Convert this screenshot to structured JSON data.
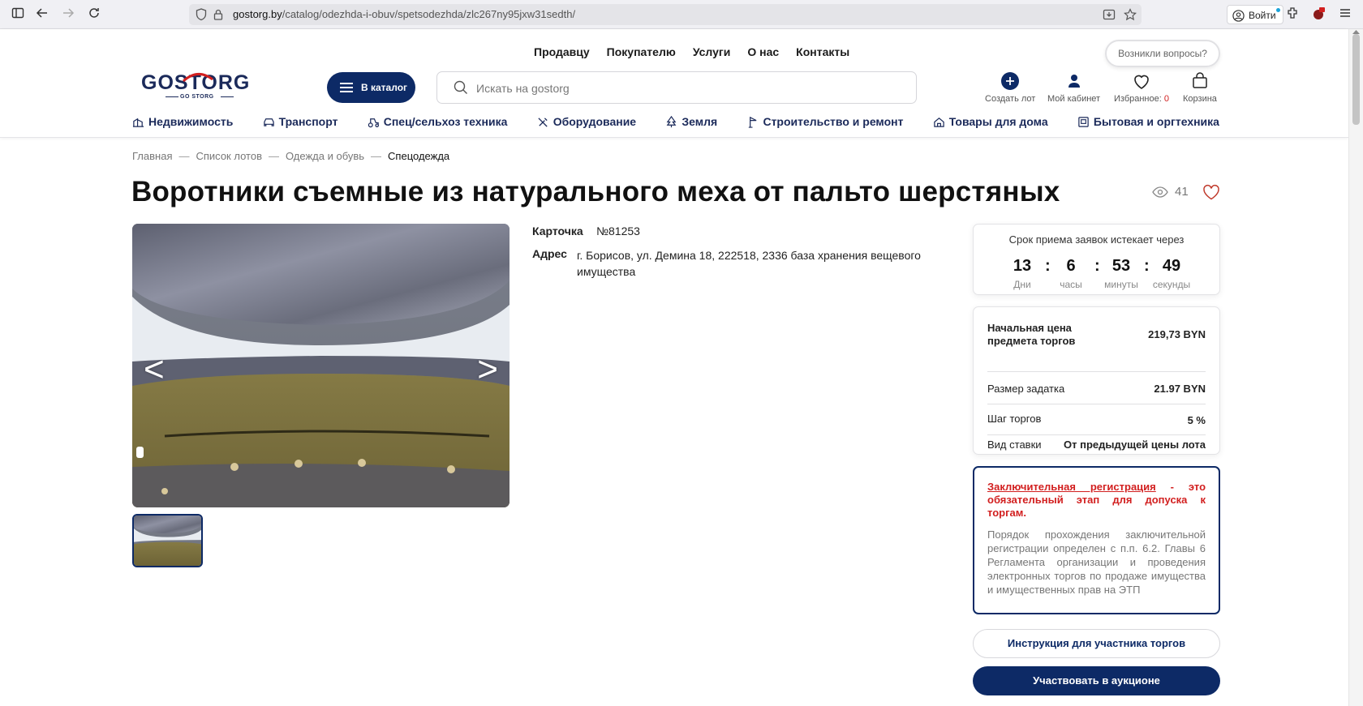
{
  "browser": {
    "url_host": "gostorg.by",
    "url_path": "/catalog/odezhda-i-obuv/spetsodezhda/zlc267ny95jxw31sedth/",
    "signin_label": "Войти"
  },
  "header": {
    "top_nav": [
      "Продавцу",
      "Покупателю",
      "Услуги",
      "О нас",
      "Контакты"
    ],
    "questions_button": "Возникли вопросы?",
    "logo_main": "GOSTORG",
    "logo_sub": "GO STORG",
    "catalog_button": "В каталог",
    "search_placeholder": "Искать на gostorg",
    "create_lot": "Создать лот",
    "my_cabinet": "Мой кабинет",
    "favorites_label": "Избранное:",
    "favorites_count": "0",
    "cart": "Корзина"
  },
  "categories": [
    "Недвижимость",
    "Транспорт",
    "Спец/сельхоз техника",
    "Оборудование",
    "Земля",
    "Строительство и ремонт",
    "Товары для дома",
    "Бытовая и оргтехника"
  ],
  "breadcrumb": [
    "Главная",
    "Список лотов",
    "Одежда и обувь",
    "Спецодежда"
  ],
  "breadcrumb_separator": "—",
  "lot": {
    "title": "Воротники съемные из натурального меха от пальто шерстяных",
    "views": "41",
    "card_label": "Карточка",
    "card_number": "№81253",
    "address_label": "Адрес",
    "address": "г. Борисов, ул. Демина 18, 222518, 2336 база хранения вещевого имущества"
  },
  "gallery": {
    "prev_arrow": "<",
    "next_arrow": ">"
  },
  "timer": {
    "title": "Срок приема заявок истекает через",
    "days": "13",
    "days_label": "Дни",
    "hours": "6",
    "hours_label": "часы",
    "minutes": "53",
    "minutes_label": "минуты",
    "seconds": "49",
    "seconds_label": "секунды",
    "separator": ":"
  },
  "pricing": {
    "start_price_label": "Начальная цена предмета торгов",
    "start_price": "219,73 BYN",
    "deposit_label": "Размер задатка",
    "deposit": "21.97 BYN",
    "step_label": "Шаг торгов",
    "step": "5 %",
    "bid_type_label": "Вид ставки",
    "bid_type": "От предыдущей цены лота"
  },
  "notice": {
    "link": "Заключительная регистрация",
    "red_text": " - это обязательный этап для допуска к торгам.",
    "grey_text": "Порядок прохождения заключительной регистрации определен с п.п. 6.2. Главы 6 Регламента организации и проведения электронных торгов по продаже имущества и имущественных прав на ЭТП"
  },
  "buttons": {
    "instruction": "Инструкция для участника торгов",
    "participate": "Участвовать в аукционе"
  },
  "colors": {
    "brand_navy": "#0d2a66",
    "accent_red": "#d21f1f"
  }
}
